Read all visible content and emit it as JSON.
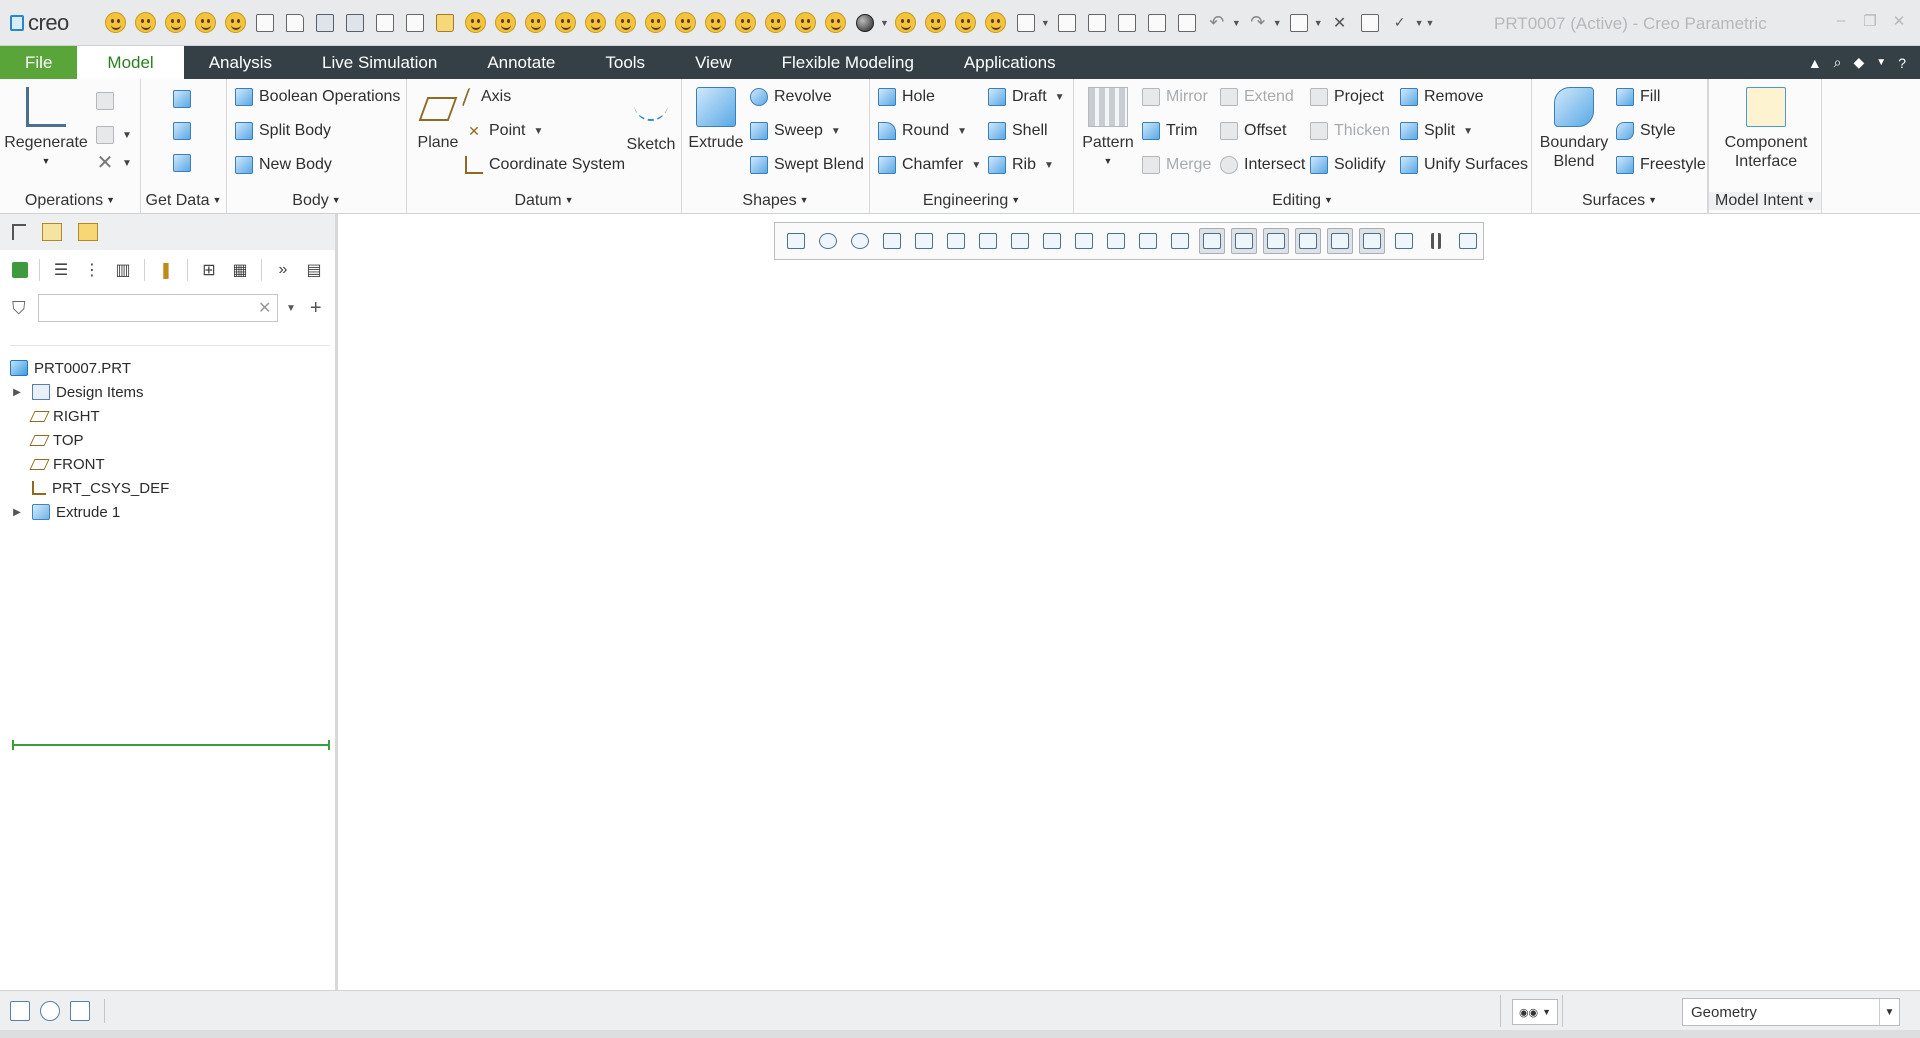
{
  "app": {
    "logo_text": "creo",
    "title": "PRT0007 (Active) - Creo Parametric"
  },
  "tabs": [
    "File",
    "Model",
    "Analysis",
    "Live Simulation",
    "Annotate",
    "Tools",
    "View",
    "Flexible Modeling",
    "Applications"
  ],
  "active_tab": "Model",
  "ribbon": {
    "operations": {
      "label": "Operations",
      "regenerate": "Regenerate"
    },
    "get_data": {
      "label": "Get Data"
    },
    "body": {
      "label": "Body",
      "boolean": "Boolean Operations",
      "split": "Split Body",
      "new": "New Body"
    },
    "datum": {
      "label": "Datum",
      "plane": "Plane",
      "axis": "Axis",
      "point": "Point",
      "csys": "Coordinate System",
      "sketch": "Sketch"
    },
    "shapes": {
      "label": "Shapes",
      "extrude": "Extrude",
      "revolve": "Revolve",
      "sweep": "Sweep",
      "swept_blend": "Swept Blend"
    },
    "engineering": {
      "label": "Engineering",
      "hole": "Hole",
      "round": "Round",
      "chamfer": "Chamfer",
      "draft": "Draft",
      "shell": "Shell",
      "rib": "Rib"
    },
    "editing": {
      "label": "Editing",
      "pattern": "Pattern",
      "mirror": "Mirror",
      "trim": "Trim",
      "merge": "Merge",
      "extend": "Extend",
      "offset": "Offset",
      "intersect": "Intersect",
      "project": "Project",
      "thicken": "Thicken",
      "solidify": "Solidify",
      "remove": "Remove",
      "split": "Split",
      "unify": "Unify Surfaces"
    },
    "surfaces": {
      "label": "Surfaces",
      "boundary_blend_1": "Boundary",
      "boundary_blend_2": "Blend",
      "fill": "Fill",
      "style": "Style",
      "freestyle": "Freestyle"
    },
    "model_intent": {
      "label": "Model Intent",
      "component_1": "Component",
      "component_2": "Interface"
    }
  },
  "model_tree": {
    "filter_value": "",
    "nodes": [
      {
        "label": "PRT0007.PRT",
        "icon": "part-icon",
        "expandable": false,
        "root": true
      },
      {
        "label": "Design Items",
        "icon": "design-items-icon",
        "expandable": true
      },
      {
        "label": "RIGHT",
        "icon": "datum-plane-icon",
        "expandable": false
      },
      {
        "label": "TOP",
        "icon": "datum-plane-icon",
        "expandable": false
      },
      {
        "label": "FRONT",
        "icon": "datum-plane-icon",
        "expandable": false
      },
      {
        "label": "PRT_CSYS_DEF",
        "icon": "csys-icon",
        "expandable": false
      },
      {
        "label": "Extrude 1",
        "icon": "extrude-icon",
        "expandable": true
      }
    ]
  },
  "status": {
    "selection_filter": "Geometry"
  },
  "colors": {
    "tab_bar": "#354046",
    "file_tab": "#5aa539",
    "active_tab_text": "#2b7f23",
    "insert_line": "#3b9d3b"
  }
}
